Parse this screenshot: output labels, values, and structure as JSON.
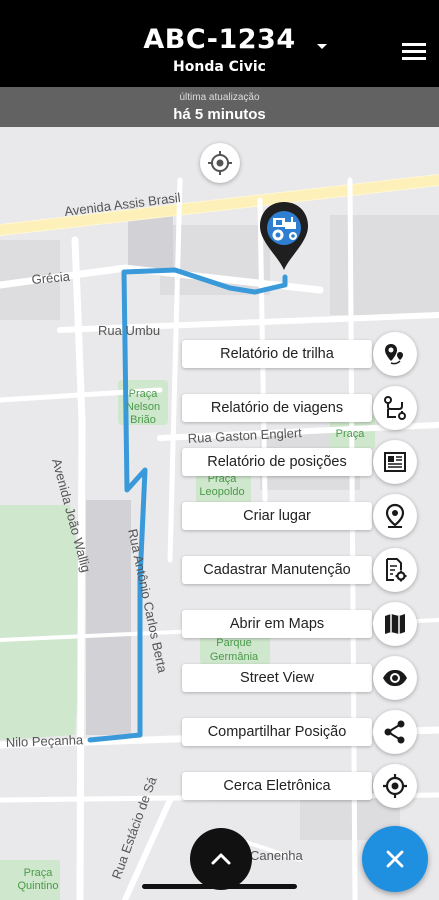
{
  "header": {
    "plate": "ABC-1234",
    "model": "Honda Civic",
    "update_label": "última atualização",
    "update_value": "há 5 minutos"
  },
  "map": {
    "streets": {
      "assis_brasil": "Avenida Assis Brasil",
      "grecia": "Grécia",
      "umbu": "Rua Umbu",
      "gaston": "Rua Gaston Englert",
      "joao_wallig": "Avenida João Wallig",
      "antonio_carlos": "Rua Antônio Carlos Berta",
      "nilo": "Nilo Peçanha",
      "estacio": "Rua Estácio de Sá",
      "sa": "de Sá",
      "canenha": "Canenha"
    },
    "places": {
      "praca_nelson_1": "Praça",
      "praca_nelson_2": "Nelson",
      "praca_nelson_3": "Brião",
      "praca_leopoldo_1": "Praça",
      "praca_leopoldo_2": "Leopoldo",
      "praca_top": "Praça",
      "parque_1": "Parque",
      "parque_2": "Germânia",
      "praca_quintino_1": "Praça",
      "praca_quintino_2": "Quintino"
    },
    "route_color": "#3a9ad9",
    "pin_color": "#1f1f1f",
    "vehicle_icon": "tractor-icon"
  },
  "actions": [
    {
      "label": "Relatório de trilha",
      "icon": "route-pin-icon"
    },
    {
      "label": "Relatório de viagens",
      "icon": "trip-route-icon"
    },
    {
      "label": "Relatório de posições",
      "icon": "newspaper-icon"
    },
    {
      "label": "Criar lugar",
      "icon": "location-pin-icon"
    },
    {
      "label": "Cadastrar Manutenção",
      "icon": "document-gear-icon"
    },
    {
      "label": "Abrir em Maps",
      "icon": "map-icon"
    },
    {
      "label": "Street View",
      "icon": "eye-icon"
    },
    {
      "label": "Compartilhar Posição",
      "icon": "share-icon"
    },
    {
      "label": "Cerca Eletrônica",
      "icon": "geofence-icon"
    }
  ],
  "fab": {
    "close_icon": "close-icon",
    "color": "#1f8fe0"
  },
  "expand": {
    "icon": "chevron-up-icon"
  }
}
